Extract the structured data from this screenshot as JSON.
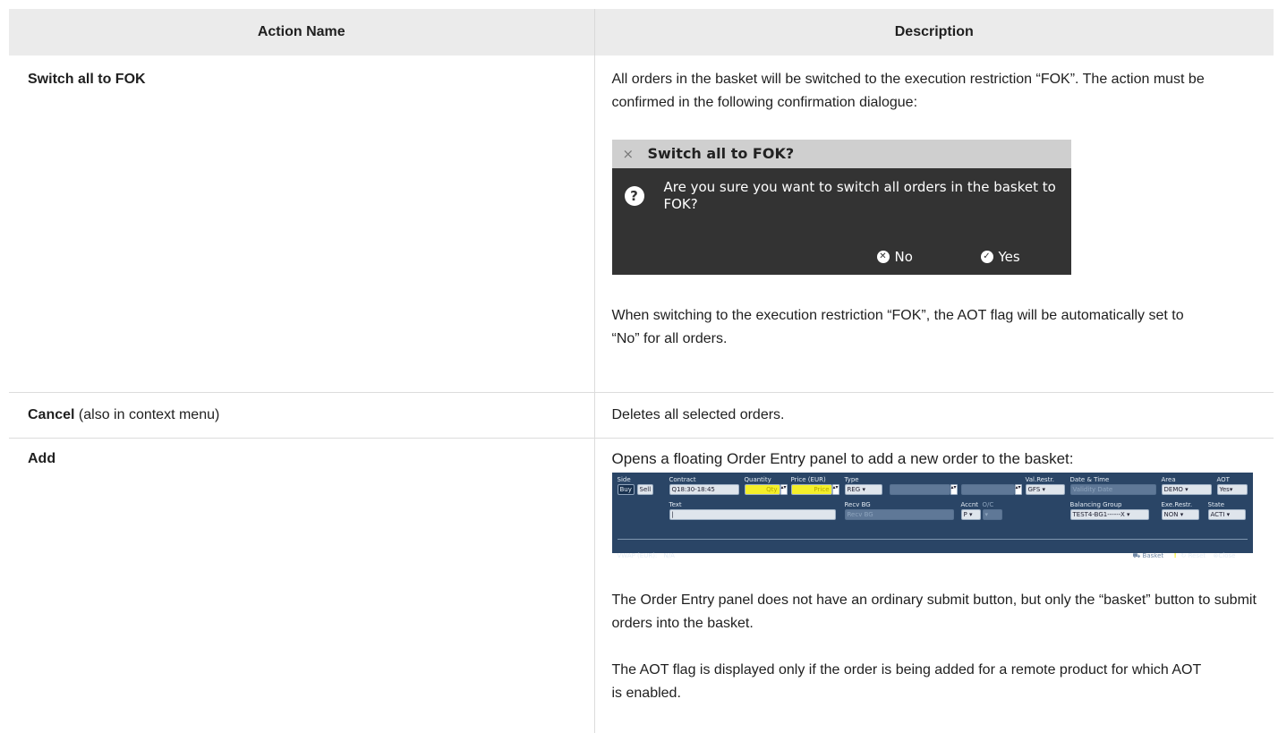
{
  "table": {
    "headers": [
      "Action Name",
      "Description"
    ]
  },
  "rows": {
    "fok": {
      "name": "Switch all to FOK",
      "desc1": "All orders in the basket will be switched to the execution restriction “FOK”. The action must be confirmed in the following confirmation dialogue:",
      "desc2": "When switching to the execution restriction “FOK”, the AOT flag will be automatically set to “No” for all orders."
    },
    "cancel": {
      "name": "Cancel",
      "suffix": " (also in context menu)",
      "desc": "Deletes all selected orders."
    },
    "add": {
      "name": "Add",
      "desc1": "Opens a floating Order Entry panel to add a new order to the basket:",
      "desc2": "The Order Entry panel does not have an ordinary submit button, but only the “basket” button to submit orders into the basket.",
      "desc3": "The AOT flag is displayed only if the order is being added for a remote product for which AOT is enabled."
    }
  },
  "dialog": {
    "title": "Switch all to FOK?",
    "message": "Are you sure you want to switch all orders in the basket to FOK?",
    "no_label": "No",
    "yes_label": "Yes",
    "close_glyph": "×",
    "question_glyph": "?"
  },
  "order_entry": {
    "labels": {
      "side": "Side",
      "contract": "Contract",
      "quantity": "Quantity",
      "price": "Price (EUR)",
      "type": "Type",
      "val_restr": "Val.Restr.",
      "date_time": "Date & Time",
      "area": "Area",
      "aot": "AOT",
      "text": "Text",
      "recv_bg": "Recv BG",
      "accnt": "Accnt",
      "oc": "O/C",
      "balancing_group": "Balancing Group",
      "exe_restr": "Exe.Restr.",
      "state": "State"
    },
    "values": {
      "buy": "Buy",
      "sell": "Sell",
      "contract": "Q18:30-18:45",
      "qty_placeholder": "Qty",
      "price_placeholder": "Price",
      "type": "REG",
      "val_restr": "GFS",
      "date_placeholder": "Validity Date",
      "area": "DEMO",
      "aot": "Yes",
      "recv_bg_placeholder": "Recv BG",
      "accnt": "P",
      "balancing_group": "TEST4-BG1------X",
      "exe_restr": "NON",
      "state": "ACTI"
    },
    "footer": {
      "vwap_label": "VWAP (EUR):",
      "vwap_value": "N/A",
      "basket": "Basket",
      "reset": "Reset",
      "close": "Close"
    }
  }
}
